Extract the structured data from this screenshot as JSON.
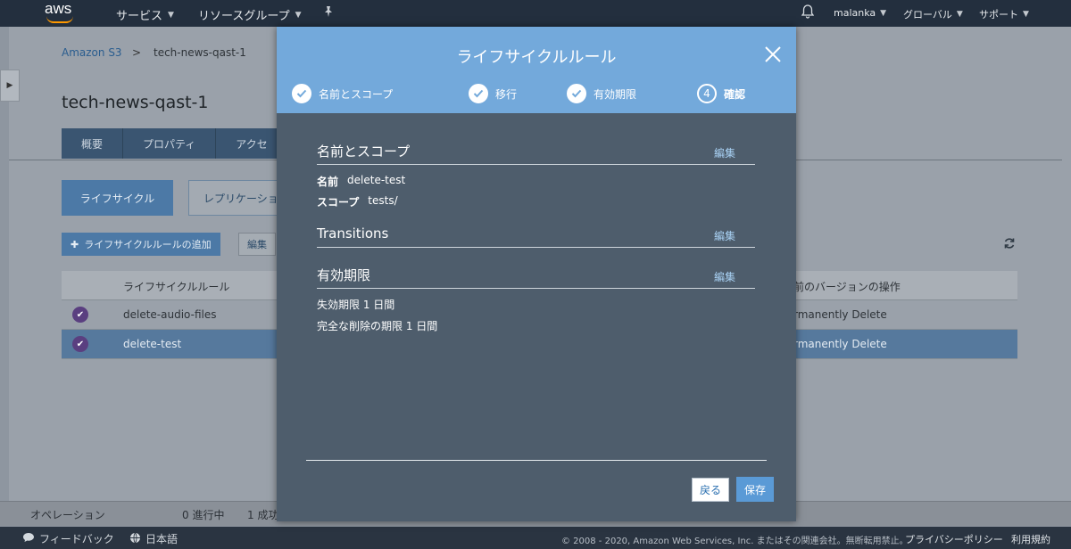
{
  "topnav": {
    "logo_text": "aws",
    "services": "サービス",
    "resource_groups": "リソースグループ",
    "user": "malanka",
    "region": "グローバル",
    "support": "サポート"
  },
  "breadcrumb": {
    "service": "Amazon S3",
    "separator": ">",
    "bucket": "tech-news-qast-1"
  },
  "page": {
    "title": "tech-news-qast-1",
    "tabs": [
      "概要",
      "プロパティ",
      "アクセ"
    ],
    "lifecycle_button": "ライフサイクル",
    "replication_button": "レプリケーショ",
    "add_rule_button": "ライフサイクルルールの追加",
    "edit_button": "編集",
    "table": {
      "header_rule": "ライフサイクルルール",
      "header_prev_version": "前のバージョンの操作",
      "rows": [
        {
          "rule": "delete-audio-files",
          "prev_action": "rmanently Delete"
        },
        {
          "rule": "delete-test",
          "prev_action": "rmanently Delete"
        }
      ]
    }
  },
  "ops": {
    "label": "オペレーション",
    "in_progress": "0 進行中",
    "success": "1 成功"
  },
  "footer": {
    "feedback": "フィードバック",
    "language": "日本語",
    "copyright": "© 2008 - 2020, Amazon Web Services, Inc. またはその関連会社。無断転用禁止。",
    "privacy": "プライバシーポリシー",
    "terms": "利用規約"
  },
  "modal": {
    "title": "ライフサイクルルール",
    "steps": [
      {
        "label": "名前とスコープ",
        "state": "done"
      },
      {
        "label": "移行",
        "state": "done"
      },
      {
        "label": "有効期限",
        "state": "done"
      },
      {
        "label": "確認",
        "state": "active",
        "number": "4"
      }
    ],
    "sections": {
      "name_scope": {
        "title": "名前とスコープ",
        "edit": "編集",
        "name_key": "名前",
        "name_value": "delete-test",
        "scope_key": "スコープ",
        "scope_value": "tests/"
      },
      "transitions": {
        "title": "Transitions",
        "edit": "編集"
      },
      "expiration": {
        "title": "有効期限",
        "edit": "編集",
        "line1": "失効期限 1 日間",
        "line2": "完全な削除の期限 1 日間"
      }
    },
    "back_button": "戻る",
    "save_button": "保存"
  },
  "colors": {
    "header_blue": "#73a9db",
    "modal_bg": "#4e5d6c",
    "nav_bg": "#232f3e",
    "accent_orange": "#ff9900"
  }
}
